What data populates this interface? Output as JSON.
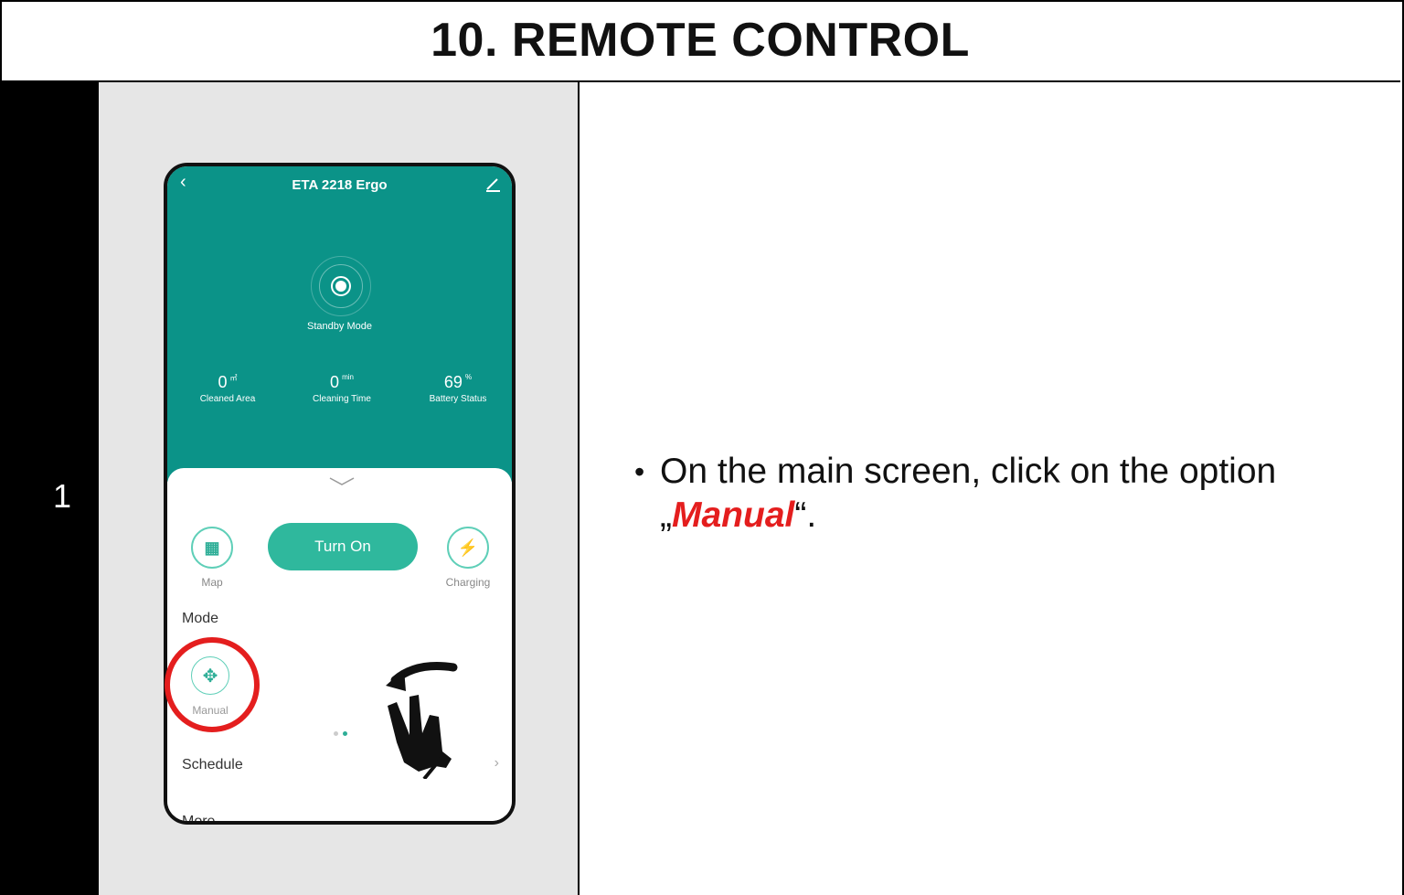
{
  "header": {
    "title": "10. REMOTE CONTROL"
  },
  "step": {
    "number": "1"
  },
  "instruction": {
    "bullet": "•",
    "line1": "On the main screen, click on the option",
    "open_quote": "„",
    "highlight": "Manual",
    "close_quote": "“."
  },
  "phone": {
    "title": "ETA 2218 Ergo",
    "back_icon": "chevron-left-icon",
    "edit_icon": "pencil-icon",
    "status": "Standby Mode",
    "stats": [
      {
        "value": "0",
        "unit": "㎡",
        "label": "Cleaned Area"
      },
      {
        "value": "0",
        "unit": "min",
        "label": "Cleaning Time"
      },
      {
        "value": "69",
        "unit": "%",
        "label": "Battery Status"
      }
    ],
    "buttons": {
      "map_label": "Map",
      "turn_on_label": "Turn On",
      "charging_label": "Charging"
    },
    "mode_title": "Mode",
    "manual_label": "Manual",
    "schedule_label": "Schedule",
    "more_label": "More",
    "accent_color": "#0b9388"
  },
  "annotation": {
    "highlight_color": "#e41e1e",
    "gesture_icon": "swipe-hand-icon"
  }
}
